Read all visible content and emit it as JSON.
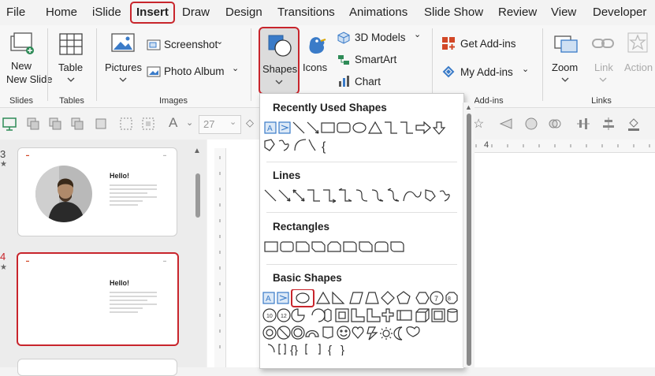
{
  "menu": {
    "tabs": [
      "File",
      "Home",
      "iSlide",
      "Insert",
      "Draw",
      "Design",
      "Transitions",
      "Animations",
      "Slide Show",
      "Review",
      "View",
      "Developer"
    ],
    "active": "Insert"
  },
  "ribbon": {
    "new_slide": "New Slide",
    "table": "Table",
    "pictures": "Pictures",
    "screenshot": "Screenshot",
    "photo_album": "Photo Album",
    "shapes": "Shapes",
    "icons": "Icons",
    "models_3d": "3D Models",
    "smartart": "SmartArt",
    "chart": "Chart",
    "get_addins": "Get Add-ins",
    "my_addins": "My Add-ins",
    "zoom": "Zoom",
    "link": "Link",
    "action": "Action",
    "groups": {
      "slides": "Slides",
      "tables": "Tables",
      "images": "Images",
      "addins": "Add-ins",
      "links": "Links"
    }
  },
  "toolbar2": {
    "font_size": "27"
  },
  "ruler": {
    "label": "4"
  },
  "slides": [
    {
      "number": "3",
      "title": "Hello!"
    },
    {
      "number": "4",
      "title": "Hello!"
    }
  ],
  "shapes_menu": {
    "recent": "Recently Used Shapes",
    "lines": "Lines",
    "rectangles": "Rectangles",
    "basic": "Basic Shapes"
  },
  "colors": {
    "accent_red": "#c8252c",
    "brand_orange": "#d24726"
  }
}
